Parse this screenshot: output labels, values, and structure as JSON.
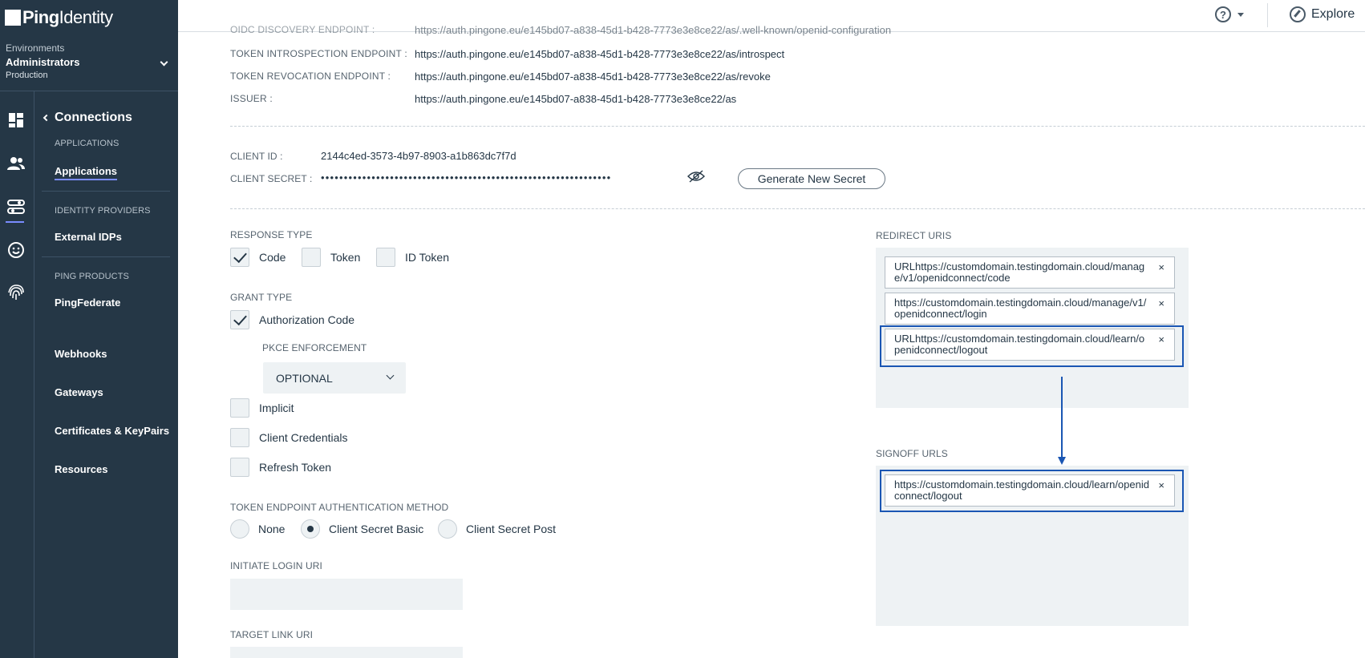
{
  "brand": {
    "name_bold": "Ping",
    "name_light": "Identity"
  },
  "environment": {
    "label": "Environments",
    "name": "Administrators",
    "type": "Production"
  },
  "nav": {
    "back_label": "Connections",
    "sections": [
      {
        "heading": "APPLICATIONS",
        "items": [
          "Applications"
        ]
      },
      {
        "heading": "IDENTITY PROVIDERS",
        "items": [
          "External IDPs"
        ]
      },
      {
        "heading": "PING PRODUCTS",
        "items": [
          "PingFederate"
        ]
      }
    ],
    "extra_items": [
      "Webhooks",
      "Gateways",
      "Certificates & KeyPairs",
      "Resources"
    ],
    "active_item": "Applications"
  },
  "rail_icons": [
    "dashboard-icon",
    "users-icon",
    "connections-icon",
    "experiences-icon",
    "fingerprint-icon"
  ],
  "topbar": {
    "help_symbol": "?",
    "explore_label": "Explore"
  },
  "endpoints": [
    {
      "label": "OIDC DISCOVERY ENDPOINT :",
      "value": "https://auth.pingone.eu/e145bd07-a838-45d1-b428-7773e3e8ce22/as/.well-known/openid-configuration"
    },
    {
      "label": "TOKEN INTROSPECTION ENDPOINT :",
      "value": "https://auth.pingone.eu/e145bd07-a838-45d1-b428-7773e3e8ce22/as/introspect"
    },
    {
      "label": "TOKEN REVOCATION ENDPOINT :",
      "value": "https://auth.pingone.eu/e145bd07-a838-45d1-b428-7773e3e8ce22/as/revoke"
    },
    {
      "label": "ISSUER :",
      "value": "https://auth.pingone.eu/e145bd07-a838-45d1-b428-7773e3e8ce22/as"
    }
  ],
  "client": {
    "id_label": "CLIENT ID :",
    "id_value": "2144c4ed-3573-4b97-8903-a1b863dc7f7d",
    "secret_label": "CLIENT SECRET :",
    "secret_masked": "•••••••••••••••••••••••••••••••••••••••••••••••••••••••••••••••",
    "generate_label": "Generate New Secret"
  },
  "response_type": {
    "label": "RESPONSE TYPE",
    "options": [
      {
        "label": "Code",
        "checked": true
      },
      {
        "label": "Token",
        "checked": false
      },
      {
        "label": "ID Token",
        "checked": false
      }
    ]
  },
  "grant_type": {
    "label": "GRANT TYPE",
    "authorization_code": {
      "label": "Authorization Code",
      "checked": true
    },
    "pkce_label": "PKCE ENFORCEMENT",
    "pkce_value": "OPTIONAL",
    "others": [
      {
        "label": "Implicit",
        "checked": false
      },
      {
        "label": "Client Credentials",
        "checked": false
      },
      {
        "label": "Refresh Token",
        "checked": false
      }
    ]
  },
  "token_auth": {
    "label": "TOKEN ENDPOINT AUTHENTICATION METHOD",
    "options": [
      {
        "label": "None",
        "selected": false
      },
      {
        "label": "Client Secret Basic",
        "selected": true
      },
      {
        "label": "Client Secret Post",
        "selected": false
      }
    ]
  },
  "initiate_login": {
    "label": "INITIATE LOGIN URI",
    "value": ""
  },
  "target_link": {
    "label": "TARGET LINK URI",
    "value": ""
  },
  "redirect_uris": {
    "label": "REDIRECT URIS",
    "items": [
      "URLhttps://customdomain.testingdomain.cloud/manage/v1/openidconnect/code",
      "https://customdomain.testingdomain.cloud/manage/v1/openidconnect/login",
      "URLhttps://customdomain.testingdomain.cloud/learn/openidconnect/logout"
    ]
  },
  "signoff_urls": {
    "label": "SIGNOFF URLS",
    "items": [
      "https://customdomain.testingdomain.cloud/learn/openidconnect/logout"
    ]
  },
  "remove_symbol": "×",
  "colors": {
    "sidebar": "#253746",
    "accent": "#7a8cff",
    "highlight": "#1a56b3",
    "field_bg": "#eef2f4"
  }
}
